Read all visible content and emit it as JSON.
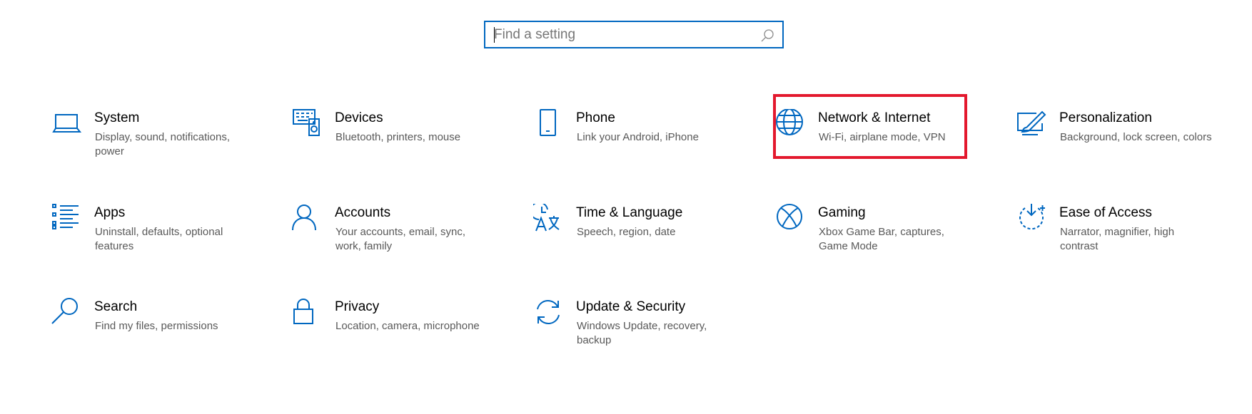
{
  "search": {
    "placeholder": "Find a setting",
    "value": ""
  },
  "accent_color": "#0067c0",
  "highlight_color": "#e3182d",
  "tiles": [
    {
      "title": "System",
      "description": "Display, sound, notifications, power",
      "icon": "laptop-icon"
    },
    {
      "title": "Devices",
      "description": "Bluetooth, printers, mouse",
      "icon": "devices-icon"
    },
    {
      "title": "Phone",
      "description": "Link your Android, iPhone",
      "icon": "phone-icon"
    },
    {
      "title": "Network & Internet",
      "description": "Wi-Fi, airplane mode, VPN",
      "icon": "globe-icon"
    },
    {
      "title": "Personalization",
      "description": "Background, lock screen, colors",
      "icon": "paintbrush-icon"
    },
    {
      "title": "Apps",
      "description": "Uninstall, defaults, optional features",
      "icon": "apps-list-icon"
    },
    {
      "title": "Accounts",
      "description": "Your accounts, email, sync, work, family",
      "icon": "person-icon"
    },
    {
      "title": "Time & Language",
      "description": "Speech, region, date",
      "icon": "time-language-icon"
    },
    {
      "title": "Gaming",
      "description": "Xbox Game Bar, captures, Game Mode",
      "icon": "xbox-icon"
    },
    {
      "title": "Ease of Access",
      "description": "Narrator, magnifier, high contrast",
      "icon": "ease-of-access-icon"
    },
    {
      "title": "Search",
      "description": "Find my files, permissions",
      "icon": "magnifier-icon"
    },
    {
      "title": "Privacy",
      "description": "Location, camera, microphone",
      "icon": "lock-icon"
    },
    {
      "title": "Update & Security",
      "description": "Windows Update, recovery, backup",
      "icon": "sync-icon"
    }
  ]
}
